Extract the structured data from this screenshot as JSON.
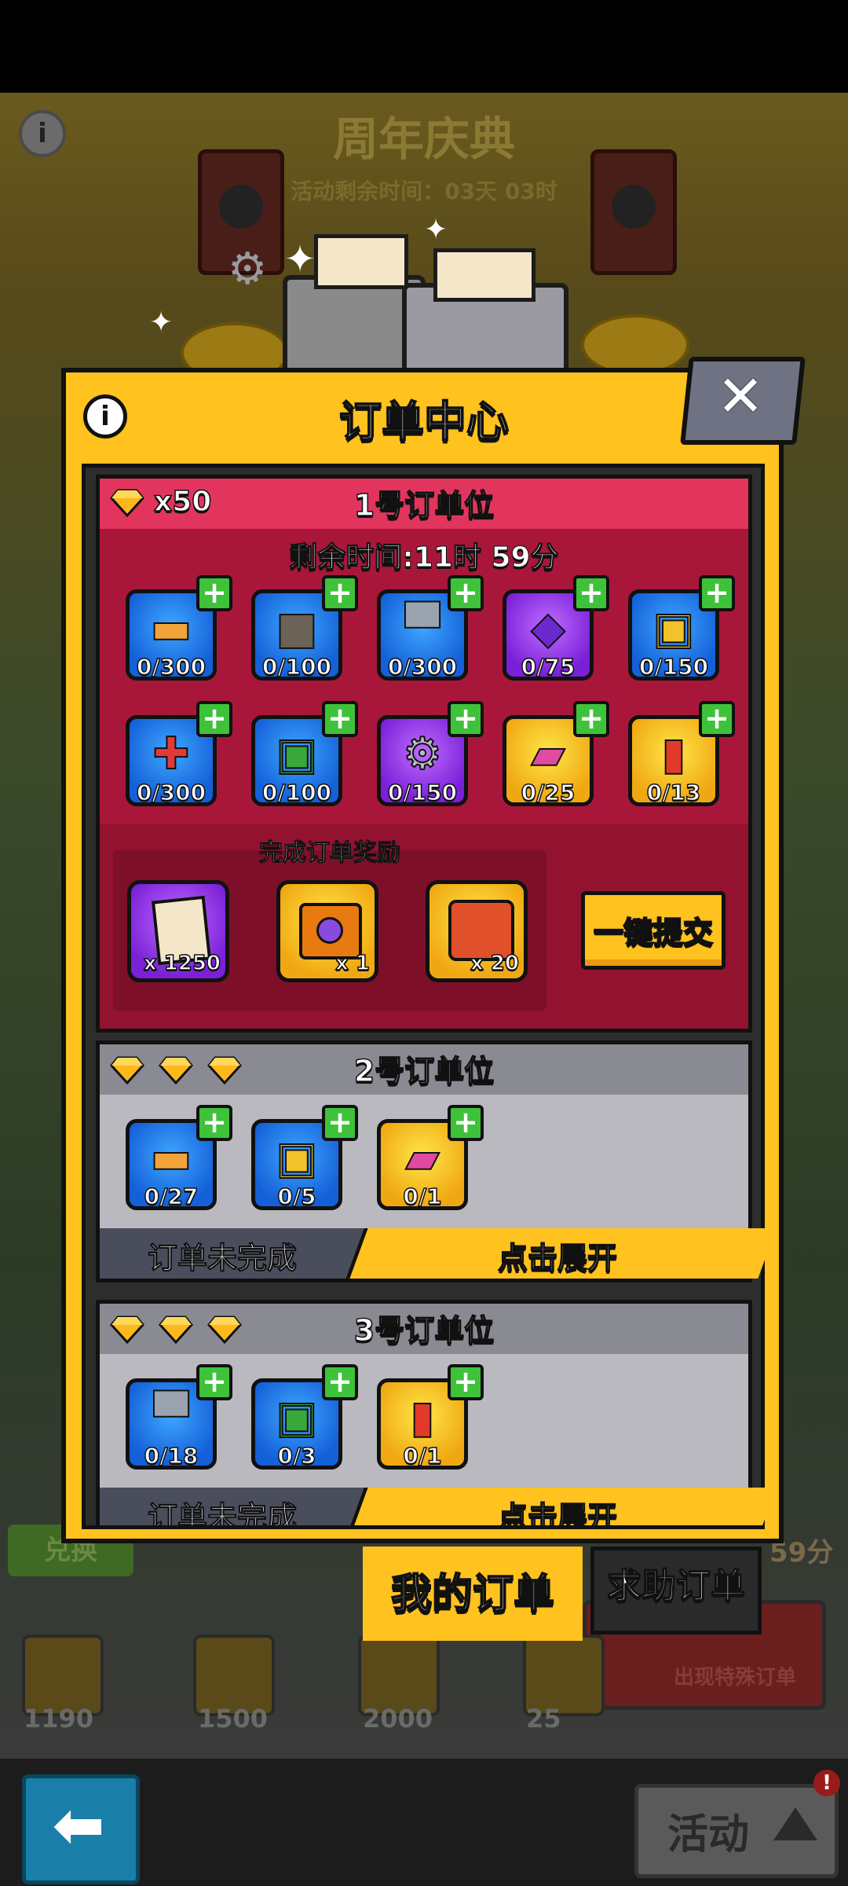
{
  "background": {
    "event_title": "周年庆典",
    "event_timer": "活动剩余时间：03天 03时",
    "info_icon": "i",
    "exchange_label": "兑换",
    "right_timer": "59分",
    "special_order_label": "出现特殊订单",
    "shop_prices": [
      "1190",
      "1500",
      "2000",
      "25"
    ]
  },
  "panel": {
    "title": "订单中心",
    "info_icon": "i",
    "close_icon": "✕"
  },
  "slot1": {
    "title": "1号订单位",
    "gem_count": "x50",
    "timer": "剩余时间:11时 59分",
    "items": [
      {
        "icon": "wood-plank",
        "count": "0/300",
        "color": "blue"
      },
      {
        "icon": "stone-block",
        "count": "0/100",
        "color": "blue"
      },
      {
        "icon": "iron-anvil",
        "count": "0/300",
        "color": "blue"
      },
      {
        "icon": "purple-crystal",
        "count": "0/75",
        "color": "purple"
      },
      {
        "icon": "toolbox-chest",
        "count": "0/150",
        "color": "blue"
      },
      {
        "icon": "medical-kit",
        "count": "0/300",
        "color": "blue"
      },
      {
        "icon": "green-toolbox",
        "count": "0/100",
        "color": "blue"
      },
      {
        "icon": "gear-part",
        "count": "0/150",
        "color": "purple"
      },
      {
        "icon": "pink-cartridge",
        "count": "0/25",
        "color": "gold"
      },
      {
        "icon": "red-canister",
        "count": "0/13",
        "color": "gold"
      }
    ],
    "reward_title": "完成订单奖励",
    "rewards": [
      {
        "icon": "paper-scroll",
        "count": "x 1250",
        "color": "purple"
      },
      {
        "icon": "treasure-chest",
        "count": "x 1",
        "color": "gold"
      },
      {
        "icon": "hero-puzzle-piece",
        "count": "x 20",
        "color": "gold"
      }
    ],
    "submit_label": "一键提交"
  },
  "slot2": {
    "title": "2号订单位",
    "items": [
      {
        "icon": "wood-plank",
        "count": "0/27",
        "color": "blue"
      },
      {
        "icon": "toolbox-chest",
        "count": "0/5",
        "color": "blue"
      },
      {
        "icon": "pink-cartridge",
        "count": "0/1",
        "color": "gold"
      }
    ],
    "status": "订单未完成",
    "expand_label": "点击展开"
  },
  "slot3": {
    "title": "3号订单位",
    "items": [
      {
        "icon": "iron-anvil",
        "count": "0/18",
        "color": "blue"
      },
      {
        "icon": "green-toolbox",
        "count": "0/3",
        "color": "blue"
      },
      {
        "icon": "red-canister",
        "count": "0/1",
        "color": "gold"
      }
    ],
    "status": "订单未完成",
    "expand_label": "点击展开"
  },
  "tabs": {
    "mine": "我的订单",
    "help": "求助订单"
  },
  "bottom": {
    "back_icon": "⬅",
    "activity_label": "活动",
    "activity_badge": "!"
  },
  "colors": {
    "panel_yellow": "#ffc21f",
    "slot1_red": "#a8173a",
    "slot1_header": "#e2355e",
    "slot_gray": "#b9b9bf",
    "plus_green": "#3ec23a"
  }
}
